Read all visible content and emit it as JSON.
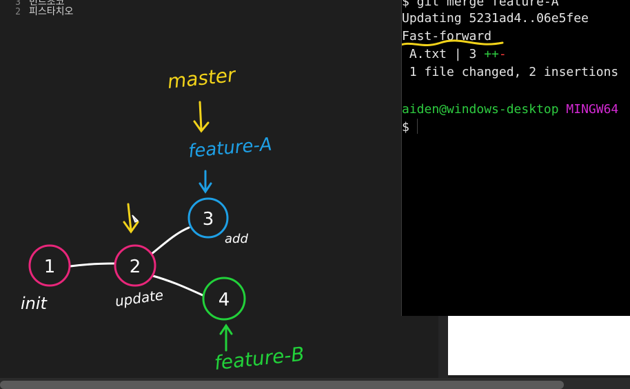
{
  "editor": {
    "lines": [
      {
        "num": "3",
        "text": "민트초코"
      },
      {
        "num": "2",
        "text": "피스타치오"
      }
    ]
  },
  "terminal": {
    "lines": {
      "cmd": "$ git merge feature-A",
      "updating": "Updating 5231ad4..06e5fee",
      "fast_forward": "Fast-forward",
      "file_stat_name": " A.txt | 3 ",
      "file_stat_plus": "++",
      "file_stat_minus": "-",
      "summary": " 1 file changed, 2 insertions",
      "prompt_user": "aiden@windows-desktop",
      "prompt_env": " MINGW64",
      "prompt_symbol": "$"
    }
  },
  "diagram": {
    "nodes": {
      "n1": "1",
      "n2": "2",
      "n3": "3",
      "n4": "4"
    },
    "labels": {
      "master": "master",
      "feature_a": "feature-A",
      "feature_b": "feature-B",
      "init": "init",
      "update": "update",
      "add": "add"
    },
    "colors": {
      "pink": "#e8267a",
      "blue": "#1ea0e6",
      "green": "#22d13a",
      "yellow": "#f2d31a",
      "white": "#ffffff"
    }
  }
}
